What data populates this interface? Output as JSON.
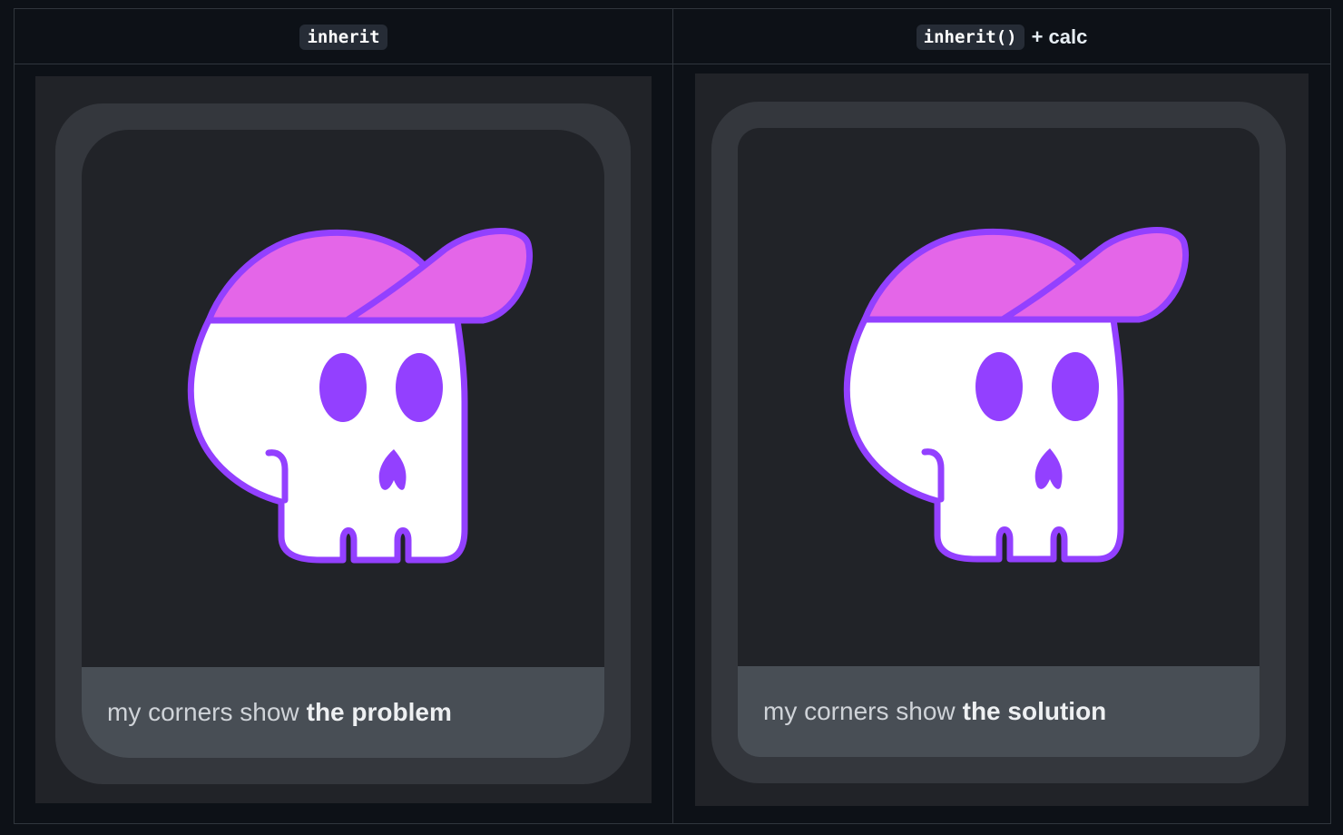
{
  "columns": [
    {
      "code": "inherit",
      "suffix": ""
    },
    {
      "code": "inherit()",
      "suffix": "+ calc"
    }
  ],
  "cards": [
    {
      "caption_prefix": "my corners show",
      "caption_bold": "the problem"
    },
    {
      "caption_prefix": "my corners show",
      "caption_bold": "the solution"
    }
  ],
  "colors": {
    "page_bg": "#0d1117",
    "stage_bg": "#212328",
    "outer_card": "#34373d",
    "caption_bar": "#484e55",
    "skull_outline": "#9340ff",
    "cap_fill": "#e466e8",
    "skull_fill": "#ffffff"
  },
  "icons": [
    "skull-with-cap-illustration"
  ]
}
